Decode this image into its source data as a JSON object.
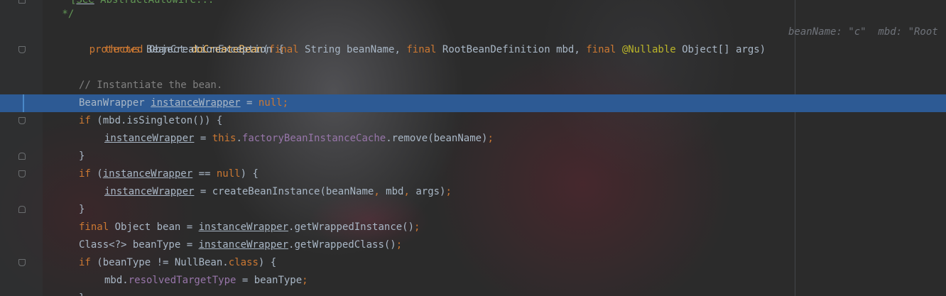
{
  "editor": {
    "lines": {
      "l0": {
        "a": "[",
        "b": "See",
        "c": " AbstractAutowire..."
      },
      "l1": {
        "a": " */"
      },
      "l2": {
        "a": "protected",
        "b": " Object ",
        "c": "doCreateBean",
        "d": "(",
        "e": "final",
        "f": " String beanName, ",
        "g": "final",
        "h": " RootBeanDefinition mbd, ",
        "i": "final",
        "j": " ",
        "k": "@Nullable",
        "l": " Object[] args)",
        "hint": "beanName: \"c\"  mbd: \"Root"
      },
      "l3": {
        "a": "throws",
        "b": " BeanCreationException {"
      },
      "l5": {
        "a": "// Instantiate the bean."
      },
      "l6": {
        "a": "BeanWrapper ",
        "b": "instanceWrapper",
        "c": " = ",
        "d": "null",
        "e": ";"
      },
      "l7": {
        "a": "if",
        "b": " (mbd.isSingleton()) {"
      },
      "l8": {
        "a": "instanceWrapper",
        "b": " = ",
        "c": "this",
        "d": ".",
        "e": "factoryBeanInstanceCache",
        "f": ".remove(beanName)",
        "g": ";"
      },
      "l9": {
        "a": "}"
      },
      "l10": {
        "a": "if",
        "b": " (",
        "c": "instanceWrapper",
        "d": " == ",
        "e": "null",
        "f": ") {"
      },
      "l11": {
        "a": "instanceWrapper",
        "b": " = createBeanInstance(beanName",
        "c": ",",
        "d": " mbd",
        "e": ",",
        "f": " args)",
        "g": ";"
      },
      "l12": {
        "a": "}"
      },
      "l13": {
        "a": "final",
        "b": " Object bean = ",
        "c": "instanceWrapper",
        "d": ".getWrappedInstance()",
        "e": ";"
      },
      "l14": {
        "a": "Class<?> beanType = ",
        "b": "instanceWrapper",
        "c": ".getWrappedClass()",
        "d": ";"
      },
      "l15": {
        "a": "if",
        "b": " (beanType != NullBean.",
        "c": "class",
        "d": ") {"
      },
      "l16": {
        "a": "mbd.",
        "b": "resolvedTargetType",
        "c": " = beanType",
        "d": ";"
      },
      "l17": {
        "a": "}"
      }
    }
  },
  "colors": {
    "background": "#2b2b2b",
    "keyword": "#cc7832",
    "method": "#ffc66d",
    "comment": "#808080",
    "field": "#9876aa",
    "annotation": "#bbb529",
    "highlight": "#2d5a94",
    "text": "#a9b7c6"
  }
}
